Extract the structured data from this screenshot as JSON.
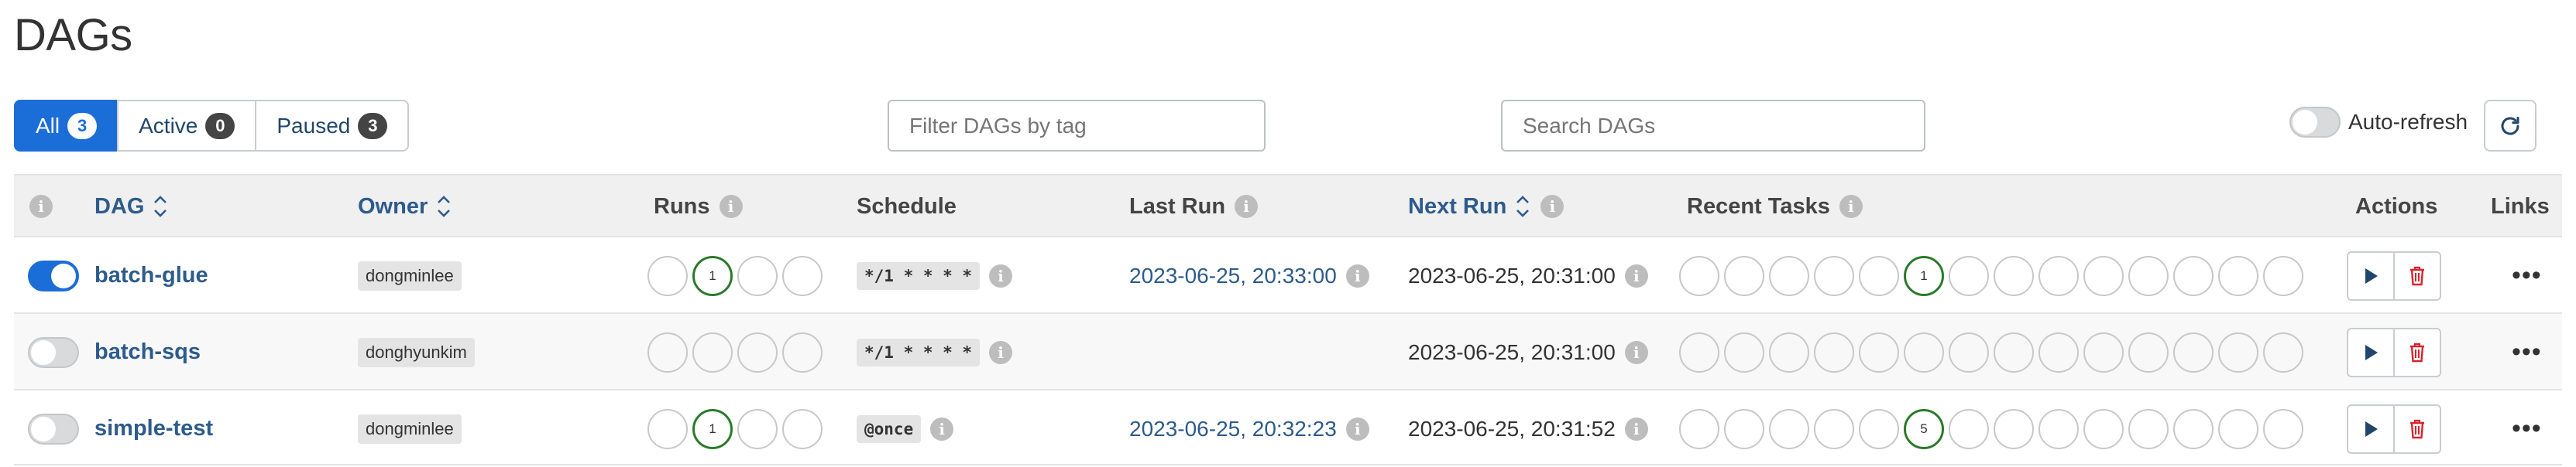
{
  "page_title": "DAGs",
  "filters": {
    "all": {
      "label": "All",
      "count": "3"
    },
    "active": {
      "label": "Active",
      "count": "0"
    },
    "paused": {
      "label": "Paused",
      "count": "3"
    }
  },
  "tag_filter": {
    "placeholder": "Filter DAGs by tag"
  },
  "search": {
    "placeholder": "Search DAGs"
  },
  "auto_refresh": {
    "label": "Auto-refresh",
    "enabled": false
  },
  "columns": {
    "dag": "DAG",
    "owner": "Owner",
    "runs": "Runs",
    "schedule": "Schedule",
    "last_run": "Last Run",
    "next_run": "Next Run",
    "recent_tasks": "Recent Tasks",
    "actions": "Actions",
    "links": "Links"
  },
  "info_glyph": "i",
  "more_glyph": "•••",
  "rows": [
    {
      "active": true,
      "dag": "batch-glue",
      "owner": "dongminlee",
      "runs": [
        "",
        "1",
        "",
        ""
      ],
      "schedule": "*/1 * * * *",
      "last_run": "2023-06-25, 20:33:00",
      "next_run": "2023-06-25, 20:31:00",
      "recent_tasks": [
        "",
        "",
        "",
        "",
        "",
        "1",
        "",
        "",
        "",
        "",
        "",
        "",
        "",
        ""
      ]
    },
    {
      "active": false,
      "dag": "batch-sqs",
      "owner": "donghyunkim",
      "runs": [
        "",
        "",
        "",
        ""
      ],
      "schedule": "*/1 * * * *",
      "last_run": "",
      "next_run": "2023-06-25, 20:31:00",
      "recent_tasks": [
        "",
        "",
        "",
        "",
        "",
        "",
        "",
        "",
        "",
        "",
        "",
        "",
        "",
        ""
      ]
    },
    {
      "active": false,
      "dag": "simple-test",
      "owner": "dongminlee",
      "runs": [
        "",
        "1",
        "",
        ""
      ],
      "schedule": "@once",
      "last_run": "2023-06-25, 20:32:23",
      "next_run": "2023-06-25, 20:31:52",
      "recent_tasks": [
        "",
        "",
        "",
        "",
        "",
        "5",
        "",
        "",
        "",
        "",
        "",
        "",
        "",
        ""
      ]
    }
  ],
  "colors": {
    "primary": "#1b6dd8",
    "link": "#2d5b8c",
    "success": "#2a7a2a",
    "delete": "#d9232d"
  }
}
